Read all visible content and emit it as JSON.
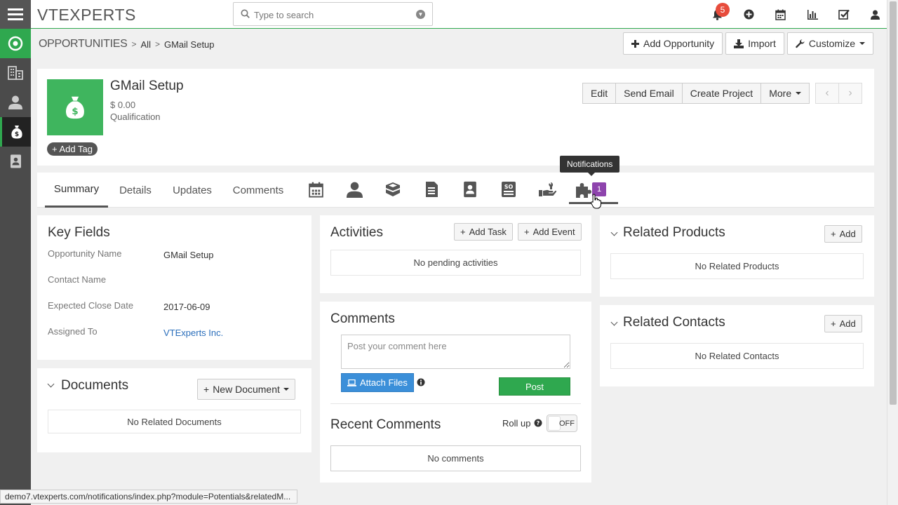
{
  "topbar": {
    "logo_text": "VTEXPERTS",
    "search_placeholder": "Type to search",
    "notification_count": "5",
    "icons": [
      "bell-icon",
      "plus-circle-icon",
      "calendar-icon",
      "bar-chart-icon",
      "task-check-icon",
      "user-icon"
    ]
  },
  "sidebar": {
    "items": [
      "home-icon",
      "building-icon",
      "person-icon",
      "money-bag-icon",
      "contact-book-icon"
    ]
  },
  "breadcrumb": {
    "module": "OPPORTUNITIES",
    "filter": "All",
    "record": "GMail Setup"
  },
  "header_buttons": {
    "add_opportunity": "Add Opportunity",
    "import": "Import",
    "customize": "Customize"
  },
  "record": {
    "name": "GMail Setup",
    "amount": "$ 0.00",
    "stage": "Qualification",
    "add_tag": "Add Tag",
    "actions": {
      "edit": "Edit",
      "send_email": "Send Email",
      "create_project": "Create Project",
      "more": "More"
    }
  },
  "tabs": {
    "summary": "Summary",
    "details": "Details",
    "updates": "Updates",
    "comments": "Comments",
    "notifications_badge": "1",
    "tooltip": "Notifications"
  },
  "key_fields": {
    "title": "Key Fields",
    "rows": [
      {
        "label": "Opportunity Name",
        "value": "GMail Setup"
      },
      {
        "label": "Contact Name",
        "value": ""
      },
      {
        "label": "Expected Close Date",
        "value": "2017-06-09"
      },
      {
        "label": "Assigned To",
        "value": "VTExperts Inc."
      }
    ]
  },
  "documents": {
    "title": "Documents",
    "new_document": "New Document",
    "empty": "No Related Documents"
  },
  "activities": {
    "title": "Activities",
    "add_task": "Add Task",
    "add_event": "Add Event",
    "empty": "No pending activities"
  },
  "comments": {
    "title": "Comments",
    "placeholder": "Post your comment here",
    "attach_files": "Attach Files",
    "post": "Post",
    "recent_title": "Recent Comments",
    "roll_up": "Roll up",
    "toggle_state": "OFF",
    "empty": "No comments"
  },
  "related_products": {
    "title": "Related Products",
    "add": "Add",
    "empty": "No Related Products"
  },
  "related_contacts": {
    "title": "Related Contacts",
    "add": "Add",
    "empty": "No Related Contacts"
  },
  "status_bar": {
    "url": "demo7.vtexperts.com/notifications/index.php?module=Potentials&relatedM..."
  },
  "colors": {
    "accent_green": "#2fa84f",
    "sidebar_bg": "#4b4b4b",
    "badge_red": "#e74c3c",
    "badge_purple": "#8e44ad",
    "link_blue": "#2a6ebb",
    "attach_blue": "#3b8fd9"
  }
}
